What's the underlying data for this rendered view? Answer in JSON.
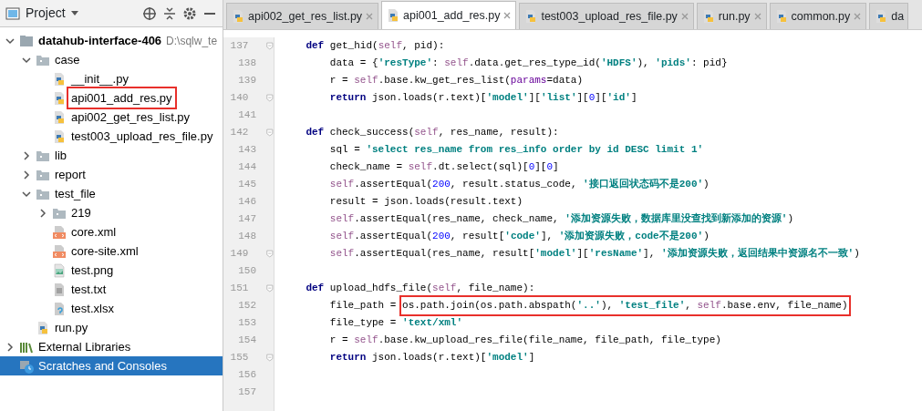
{
  "sidebar": {
    "title": "Project",
    "tree": [
      {
        "label": "datahub-interface-406",
        "path": "D:\\sqlw_te",
        "kind": "module",
        "expanded": true,
        "selected": false,
        "children": [
          {
            "label": "case",
            "kind": "folder",
            "expanded": true,
            "selected": false,
            "children": [
              {
                "label": "__init__.py",
                "kind": "python",
                "selected": false
              },
              {
                "label": "api001_add_res.py",
                "kind": "python",
                "selected": false,
                "annotated": true
              },
              {
                "label": "api002_get_res_list.py",
                "kind": "python",
                "selected": false
              },
              {
                "label": "test003_upload_res_file.py",
                "kind": "python",
                "selected": false
              }
            ]
          },
          {
            "label": "lib",
            "kind": "folder",
            "expanded": false,
            "selected": false
          },
          {
            "label": "report",
            "kind": "folder",
            "expanded": false,
            "selected": false
          },
          {
            "label": "test_file",
            "kind": "folder",
            "expanded": true,
            "selected": false,
            "children": [
              {
                "label": "219",
                "kind": "folder",
                "expanded": false,
                "selected": false
              },
              {
                "label": "core.xml",
                "kind": "xml",
                "selected": false
              },
              {
                "label": "core-site.xml",
                "kind": "xml",
                "selected": false
              },
              {
                "label": "test.png",
                "kind": "image",
                "selected": false
              },
              {
                "label": "test.txt",
                "kind": "text",
                "selected": false
              },
              {
                "label": "test.xlsx",
                "kind": "unknown",
                "selected": false
              }
            ]
          },
          {
            "label": "run.py",
            "kind": "python",
            "selected": false
          }
        ]
      },
      {
        "label": "External Libraries",
        "kind": "libraries",
        "expanded": false,
        "selected": false
      },
      {
        "label": "Scratches and Consoles",
        "kind": "scratches",
        "selected": true
      }
    ]
  },
  "tabs": [
    {
      "label": "api002_get_res_list.py",
      "selected": false,
      "closable": true
    },
    {
      "label": "api001_add_res.py",
      "selected": true,
      "closable": true
    },
    {
      "label": "test003_upload_res_file.py",
      "selected": false,
      "closable": true
    },
    {
      "label": "run.py",
      "selected": false,
      "closable": true
    },
    {
      "label": "common.py",
      "selected": false,
      "closable": true
    },
    {
      "label": "da",
      "selected": false,
      "closable": false
    }
  ],
  "editor": {
    "lines": [
      {
        "number": "137",
        "fold": true,
        "tokens": [
          {
            "kind": "kw",
            "text": "    def"
          },
          {
            "kind": "plain",
            "text": " get_hid("
          },
          {
            "kind": "self",
            "text": "self"
          },
          {
            "kind": "plain",
            "text": ", pid):"
          }
        ]
      },
      {
        "number": "138",
        "fold": false,
        "tokens": [
          {
            "kind": "plain",
            "text": "        data = {"
          },
          {
            "kind": "str",
            "text": "'resType'"
          },
          {
            "kind": "plain",
            "text": ": "
          },
          {
            "kind": "self",
            "text": "self"
          },
          {
            "kind": "plain",
            "text": ".data.get_res_type_id("
          },
          {
            "kind": "str",
            "text": "'HDFS'"
          },
          {
            "kind": "plain",
            "text": "), "
          },
          {
            "kind": "str",
            "text": "'pids'"
          },
          {
            "kind": "plain",
            "text": ": pid}"
          }
        ]
      },
      {
        "number": "139",
        "fold": false,
        "tokens": [
          {
            "kind": "plain",
            "text": "        r = "
          },
          {
            "kind": "self",
            "text": "self"
          },
          {
            "kind": "plain",
            "text": ".base.kw_get_res_list("
          },
          {
            "kind": "param",
            "text": "params"
          },
          {
            "kind": "plain",
            "text": "=data)"
          }
        ]
      },
      {
        "number": "140",
        "fold": true,
        "tokens": [
          {
            "kind": "kw",
            "text": "        return"
          },
          {
            "kind": "plain",
            "text": " json.loads(r.text)["
          },
          {
            "kind": "str",
            "text": "'model'"
          },
          {
            "kind": "plain",
            "text": "]["
          },
          {
            "kind": "str",
            "text": "'list'"
          },
          {
            "kind": "plain",
            "text": "]["
          },
          {
            "kind": "num",
            "text": "0"
          },
          {
            "kind": "plain",
            "text": "]["
          },
          {
            "kind": "str",
            "text": "'id'"
          },
          {
            "kind": "plain",
            "text": "]"
          }
        ]
      },
      {
        "number": "141",
        "fold": false
      },
      {
        "number": "142",
        "fold": true,
        "tokens": [
          {
            "kind": "kw",
            "text": "    def"
          },
          {
            "kind": "plain",
            "text": " check_success("
          },
          {
            "kind": "self",
            "text": "self"
          },
          {
            "kind": "plain",
            "text": ", res_name, result):"
          }
        ]
      },
      {
        "number": "143",
        "fold": false,
        "tokens": [
          {
            "kind": "plain",
            "text": "        sql = "
          },
          {
            "kind": "str",
            "text": "'select res_name from res_info order by id DESC limit 1'"
          }
        ]
      },
      {
        "number": "144",
        "fold": false,
        "tokens": [
          {
            "kind": "plain",
            "text": "        check_name = "
          },
          {
            "kind": "self",
            "text": "self"
          },
          {
            "kind": "plain",
            "text": ".dt.select(sql)["
          },
          {
            "kind": "num",
            "text": "0"
          },
          {
            "kind": "plain",
            "text": "]["
          },
          {
            "kind": "num",
            "text": "0"
          },
          {
            "kind": "plain",
            "text": "]"
          }
        ]
      },
      {
        "number": "145",
        "fold": false,
        "tokens": [
          {
            "kind": "self",
            "text": "        self"
          },
          {
            "kind": "plain",
            "text": ".assertEqual("
          },
          {
            "kind": "num",
            "text": "200"
          },
          {
            "kind": "plain",
            "text": ", result.status_code, "
          },
          {
            "kind": "str",
            "text": "'接口返回状态码不是200'"
          },
          {
            "kind": "plain",
            "text": ")"
          }
        ]
      },
      {
        "number": "146",
        "fold": false,
        "tokens": [
          {
            "kind": "plain",
            "text": "        result = json.loads(result.text)"
          }
        ]
      },
      {
        "number": "147",
        "fold": false,
        "tokens": [
          {
            "kind": "self",
            "text": "        self"
          },
          {
            "kind": "plain",
            "text": ".assertEqual(res_name, check_name, "
          },
          {
            "kind": "str",
            "text": "'添加资源失败，数据库里没查找到新添加的资源'"
          },
          {
            "kind": "plain",
            "text": ")"
          }
        ]
      },
      {
        "number": "148",
        "fold": false,
        "tokens": [
          {
            "kind": "self",
            "text": "        self"
          },
          {
            "kind": "plain",
            "text": ".assertEqual("
          },
          {
            "kind": "num",
            "text": "200"
          },
          {
            "kind": "plain",
            "text": ", result["
          },
          {
            "kind": "str",
            "text": "'code'"
          },
          {
            "kind": "plain",
            "text": "], "
          },
          {
            "kind": "str",
            "text": "'添加资源失败，code不是200'"
          },
          {
            "kind": "plain",
            "text": ")"
          }
        ]
      },
      {
        "number": "149",
        "fold": true,
        "tokens": [
          {
            "kind": "self",
            "text": "        self"
          },
          {
            "kind": "plain",
            "text": ".assertEqual(res_name, result["
          },
          {
            "kind": "str",
            "text": "'model'"
          },
          {
            "kind": "plain",
            "text": "]["
          },
          {
            "kind": "str",
            "text": "'resName'"
          },
          {
            "kind": "plain",
            "text": "], "
          },
          {
            "kind": "str",
            "text": "'添加资源失败，返回结果中资源名不一致'"
          },
          {
            "kind": "plain",
            "text": ")"
          }
        ]
      },
      {
        "number": "150",
        "fold": false
      },
      {
        "number": "151",
        "fold": true,
        "tokens": [
          {
            "kind": "kw",
            "text": "    def"
          },
          {
            "kind": "plain",
            "text": " upload_hdfs_file("
          },
          {
            "kind": "self",
            "text": "self"
          },
          {
            "kind": "plain",
            "text": ", file_name):"
          }
        ]
      },
      {
        "number": "152",
        "fold": false,
        "tokens": [
          {
            "kind": "plain",
            "text": "        file_path = "
          }
        ],
        "boxed_tokens": [
          {
            "kind": "plain",
            "text": "os.path.join(os.path.abspath("
          },
          {
            "kind": "str",
            "text": "'..'"
          },
          {
            "kind": "plain",
            "text": "), "
          },
          {
            "kind": "str",
            "text": "'test_file'"
          },
          {
            "kind": "plain",
            "text": ", "
          },
          {
            "kind": "self",
            "text": "self"
          },
          {
            "kind": "plain",
            "text": ".base.env, file_name)"
          }
        ]
      },
      {
        "number": "153",
        "fold": false,
        "tokens": [
          {
            "kind": "plain",
            "text": "        file_type = "
          },
          {
            "kind": "str",
            "text": "'text/xml'"
          }
        ]
      },
      {
        "number": "154",
        "fold": false,
        "tokens": [
          {
            "kind": "plain",
            "text": "        r = "
          },
          {
            "kind": "self",
            "text": "self"
          },
          {
            "kind": "plain",
            "text": ".base.kw_upload_res_file(file_name, file_path, file_type)"
          }
        ]
      },
      {
        "number": "155",
        "fold": true,
        "tokens": [
          {
            "kind": "kw",
            "text": "        return"
          },
          {
            "kind": "plain",
            "text": " json.loads(r.text)["
          },
          {
            "kind": "str",
            "text": "'model'"
          },
          {
            "kind": "plain",
            "text": "]"
          }
        ]
      },
      {
        "number": "156",
        "fold": false
      },
      {
        "number": "157",
        "fold": false
      }
    ]
  }
}
